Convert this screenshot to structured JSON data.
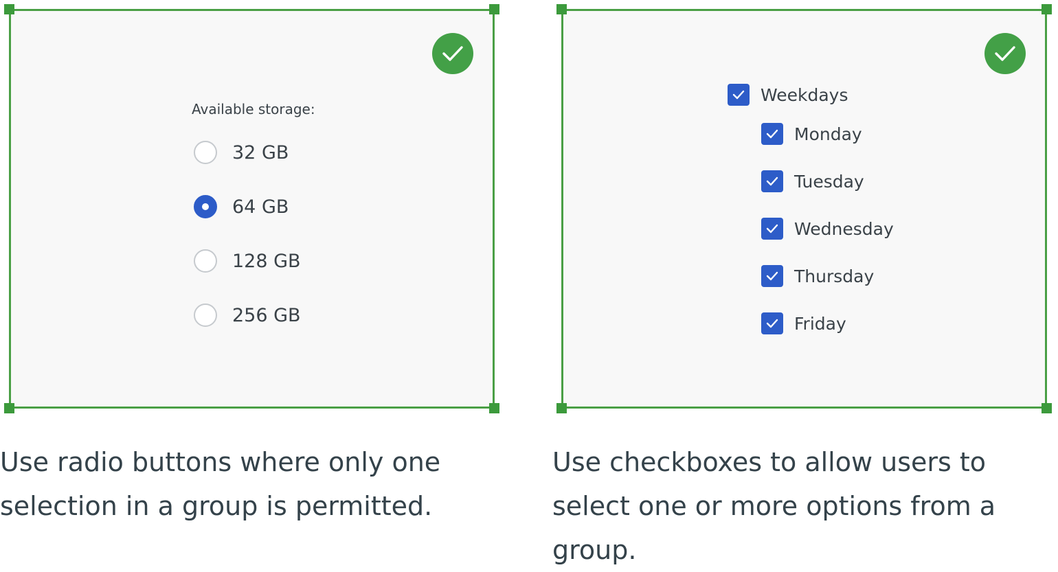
{
  "colors": {
    "success_green": "#43a047",
    "frame_green": "#4a9f45",
    "control_blue": "#2d5cc8",
    "panel_background": "#f8f8f8",
    "text": "#3a4248"
  },
  "radio_example": {
    "badge_icon": "checkmark-icon",
    "label": "Available storage:",
    "options": [
      {
        "label": "32 GB",
        "selected": false
      },
      {
        "label": "64 GB",
        "selected": true
      },
      {
        "label": "128 GB",
        "selected": false
      },
      {
        "label": "256 GB",
        "selected": false
      }
    ],
    "caption": "Use radio buttons where only one selection in a group is permitted."
  },
  "checkbox_example": {
    "badge_icon": "checkmark-icon",
    "parent": {
      "label": "Weekdays",
      "checked": true
    },
    "children": [
      {
        "label": "Monday",
        "checked": true
      },
      {
        "label": "Tuesday",
        "checked": true
      },
      {
        "label": "Wednesday",
        "checked": true
      },
      {
        "label": "Thursday",
        "checked": true
      },
      {
        "label": "Friday",
        "checked": true
      }
    ],
    "caption": "Use checkboxes to allow users to select one or more options from a group."
  }
}
